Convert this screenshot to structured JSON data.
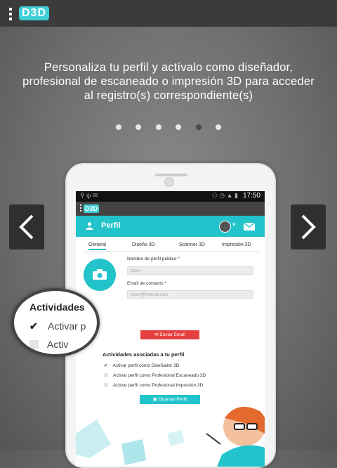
{
  "topbar": {
    "logo_text": "D3D",
    "menu_icon": "menu-dots-icon"
  },
  "headline": "Personaliza tu perfil y actívalo como diseñador, profesional de escaneado o impresión 3D para acceder al registro(s) correspondiente(s)",
  "pager": {
    "count": 6,
    "active_index": 4
  },
  "nav": {
    "prev_icon": "chevron-left-icon",
    "next_icon": "chevron-right-icon"
  },
  "phone": {
    "status_time": "17:50",
    "app_logo": "D3D",
    "profile_title": "Perfil",
    "tabs": [
      "General",
      "Diseño 3D",
      "Scanner 3D",
      "Impresión 3D"
    ],
    "form": {
      "name_label": "Nombre de perfil público *",
      "name_placeholder": "jdoen",
      "email_label": "Email de contacto *",
      "email_placeholder": "jdoen@hotmail.com",
      "send_email": "Enviar Email"
    },
    "activities_title": "Actividades asociadas a tu perfil",
    "activities": [
      {
        "label": "Activar perfil como Diseñador 3D",
        "checked": true
      },
      {
        "label": "Activar perfil como Profesional Escaneado 3D",
        "checked": false
      },
      {
        "label": "Activar perfil como Profesional Impresión 3D",
        "checked": false
      }
    ],
    "save_button": "Guardar Perfil"
  },
  "magnifier": {
    "title": "Actividades",
    "row1": "Activar p",
    "row2": "Activ"
  },
  "colors": {
    "accent": "#22c3cb",
    "danger": "#e5403f",
    "topbar": "#3b3b3b"
  }
}
